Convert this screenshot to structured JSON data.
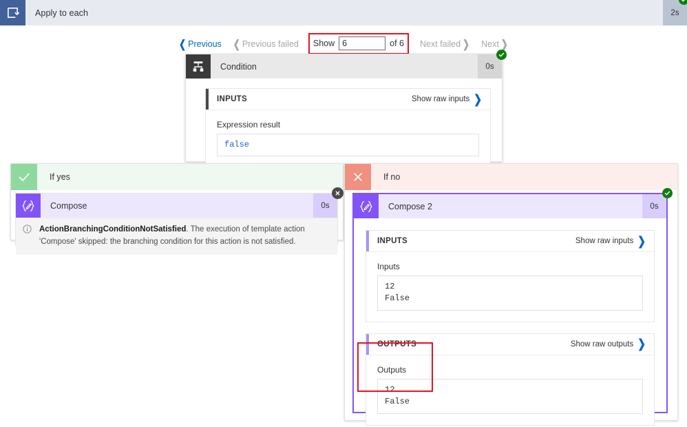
{
  "window": {
    "title": "Apply to each",
    "icon": "loop-icon",
    "duration": "2s",
    "status": "succeeded"
  },
  "pager": {
    "previous_label": "Previous",
    "previous_failed_label": "Previous failed",
    "show_label": "Show",
    "show_value": "6",
    "of_label": "of 6",
    "next_failed_label": "Next failed",
    "next_label": "Next",
    "highlight_color": "#e81123"
  },
  "condition": {
    "title": "Condition",
    "icon": "condition-branch-icon",
    "duration": "0s",
    "status": "succeeded",
    "inputs": {
      "header": "INPUTS",
      "raw_link": "Show raw inputs",
      "field_label": "Expression result",
      "value": "false"
    }
  },
  "branches": {
    "yes": {
      "label": "If yes",
      "icon": "check-icon",
      "accent": "#8fd99f",
      "action": {
        "title": "Compose",
        "icon": "compose-icon",
        "duration": "0s",
        "status": "skipped",
        "message_code": "ActionBranchingConditionNotSatisfied",
        "message_rest": ". The execution of template action 'Compose' skipped: the branching condition for this action is not satisfied.",
        "message_icon": "info-icon"
      }
    },
    "no": {
      "label": "If no",
      "icon": "close-icon",
      "accent": "#f1907f",
      "action": {
        "title": "Compose 2",
        "icon": "compose-icon",
        "duration": "0s",
        "status": "succeeded",
        "inputs": {
          "header": "INPUTS",
          "raw_link": "Show raw inputs",
          "field_label": "Inputs",
          "value": "12\nFalse"
        },
        "outputs": {
          "header": "OUTPUTS",
          "raw_link": "Show raw outputs",
          "field_label": "Outputs",
          "value": "12\nFalse"
        }
      }
    }
  },
  "colors": {
    "accent_blue": "#0067b8",
    "purple": "#8254f8",
    "purple_light": "#ede7fe",
    "success_green": "#107c10",
    "skip_grey": "#4a4a4a",
    "highlight_red": "#e81123",
    "titlebar_bg": "#e8eaf1",
    "titlebar_icon_bg": "#41619b"
  }
}
